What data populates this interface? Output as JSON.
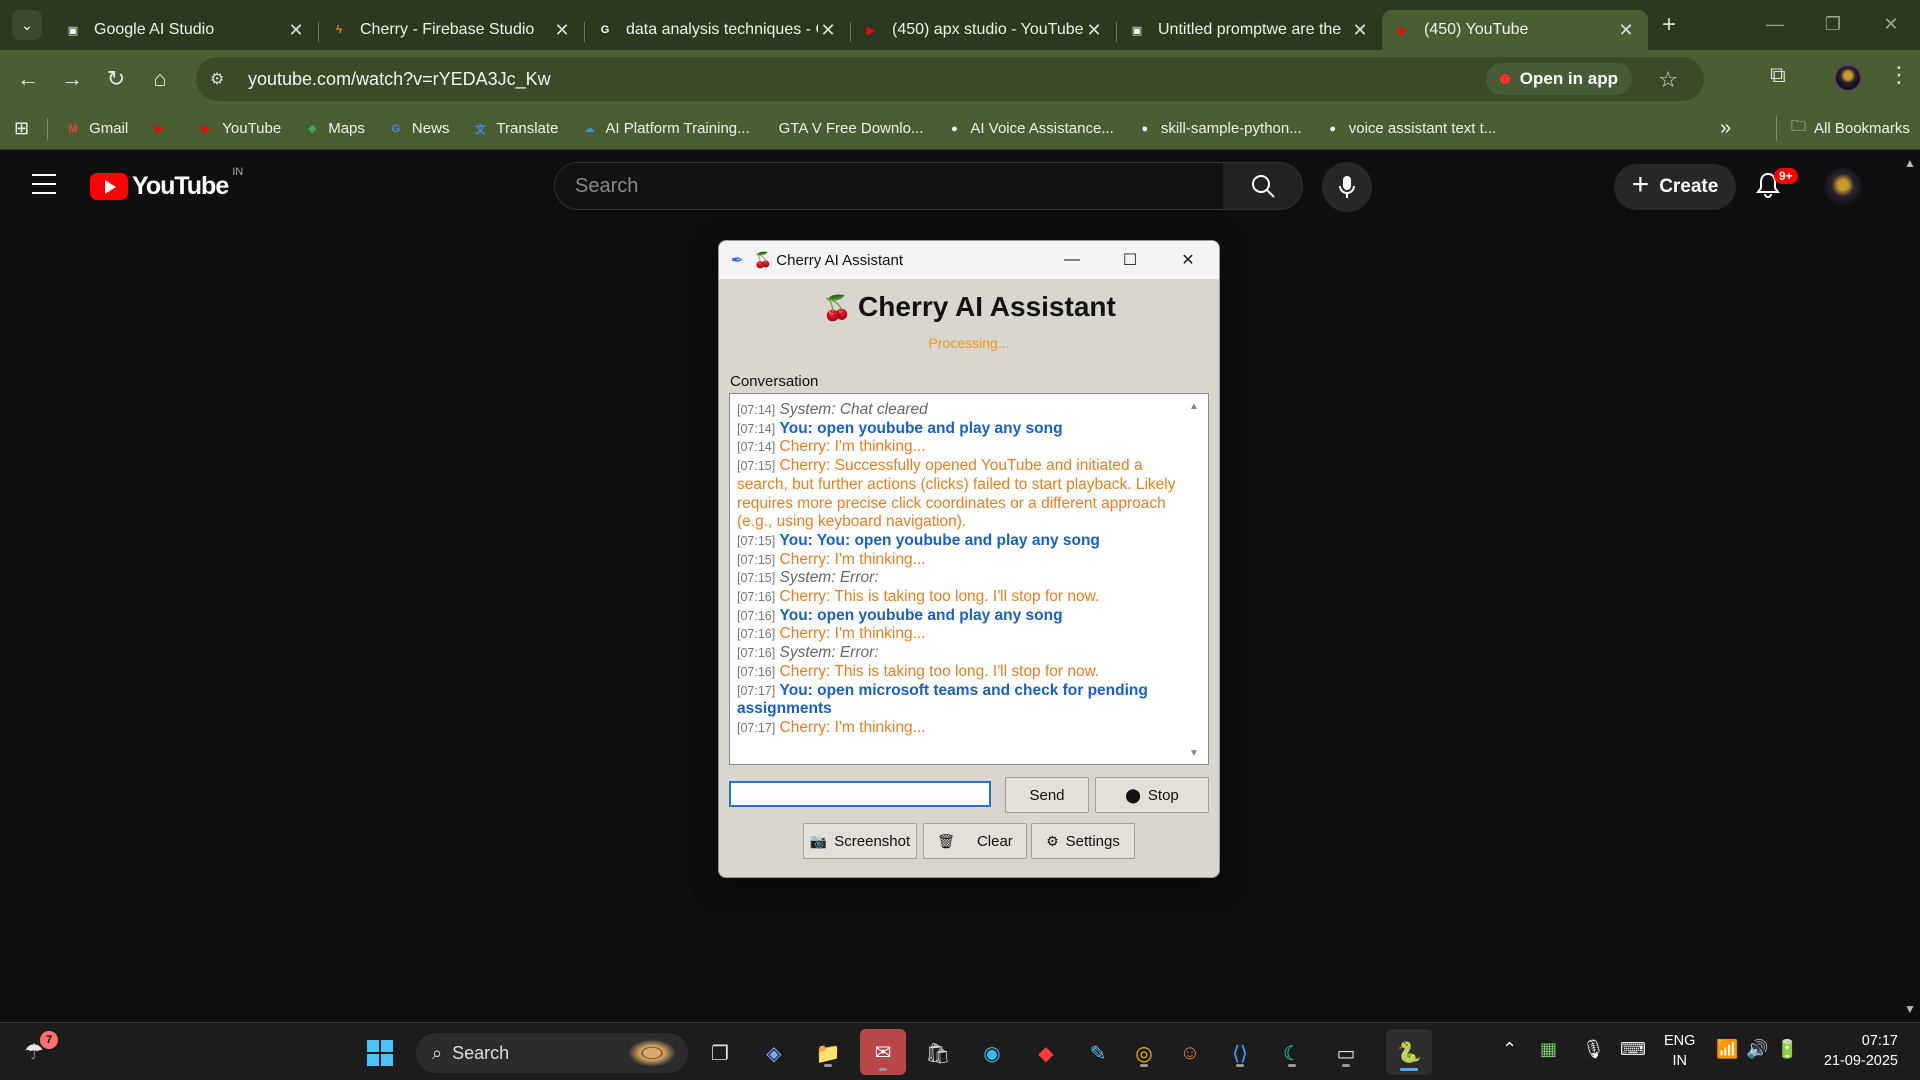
{
  "browser": {
    "tabs": [
      {
        "title": "Google AI Studio",
        "active": false,
        "fav_color": "#ffffff",
        "fav_glyph": "▣"
      },
      {
        "title": "Cherry - Firebase Studio",
        "active": false,
        "fav_color": "#ff7a1a",
        "fav_glyph": "ϟ"
      },
      {
        "title": "data analysis techniques - G",
        "active": false,
        "fav_color": "#ffffff",
        "fav_glyph": "G"
      },
      {
        "title": "(450) apx studio - YouTube",
        "active": false,
        "fav_color": "#ff0000",
        "fav_glyph": "▶"
      },
      {
        "title": "Untitled promptwe are the",
        "active": false,
        "fav_color": "#ffffff",
        "fav_glyph": "▣"
      },
      {
        "title": "(450) YouTube",
        "active": true,
        "fav_color": "#ff0000",
        "fav_glyph": "▶"
      }
    ],
    "url": "youtube.com/watch?v=rYEDA3Jc_Kw",
    "open_in_app": "Open in app",
    "bookmarks": [
      {
        "label": "Gmail",
        "color": "#ea4335",
        "glyph": "M"
      },
      {
        "label": "",
        "color": "#ff0000",
        "glyph": "▶"
      },
      {
        "label": "YouTube",
        "color": "#ff0000",
        "glyph": "▶"
      },
      {
        "label": "Maps",
        "color": "#34a853",
        "glyph": "◆"
      },
      {
        "label": "News",
        "color": "#4285f4",
        "glyph": "G"
      },
      {
        "label": "Translate",
        "color": "#4285f4",
        "glyph": "文"
      },
      {
        "label": "AI Platform Training...",
        "color": "#4285f4",
        "glyph": "☁"
      },
      {
        "label": "GTA V Free Downlo...",
        "color": "transparent",
        "glyph": ""
      },
      {
        "label": "AI Voice Assistance...",
        "color": "#ffffff",
        "glyph": "●"
      },
      {
        "label": "skill-sample-python...",
        "color": "#ffffff",
        "glyph": "●"
      },
      {
        "label": "voice assistant text t...",
        "color": "#ffffff",
        "glyph": "●"
      }
    ],
    "all_bookmarks": "All Bookmarks"
  },
  "youtube": {
    "wordmark": "YouTube",
    "country": "IN",
    "search_placeholder": "Search",
    "create_label": "Create",
    "notif_badge": "9+"
  },
  "app": {
    "window_title": "Cherry AI Assistant",
    "heading": "Cherry AI Assistant",
    "status": "Processing...",
    "conversation_label": "Conversation",
    "messages": [
      {
        "time": "[07:14]",
        "kind": "sys",
        "text": "System: Chat cleared"
      },
      {
        "time": "[07:14]",
        "kind": "you",
        "text": "You: open youbube and play any song"
      },
      {
        "time": "[07:14]",
        "kind": "ch",
        "text": "Cherry: I'm thinking..."
      },
      {
        "time": "[07:15]",
        "kind": "ch",
        "text": "Cherry: Successfully opened YouTube and initiated a search, but further actions (clicks) failed to start playback. Likely requires more precise click coordinates or a different approach (e.g., using keyboard navigation)."
      },
      {
        "time": "[07:15]",
        "kind": "you",
        "text": "You: You: open youbube and play any song"
      },
      {
        "time": "[07:15]",
        "kind": "ch",
        "text": "Cherry: I'm thinking..."
      },
      {
        "time": "[07:15]",
        "kind": "sys",
        "text": "System: Error:"
      },
      {
        "time": "[07:16]",
        "kind": "ch",
        "text": "Cherry: This is taking too long. I'll stop for now."
      },
      {
        "time": "[07:16]",
        "kind": "you",
        "text": "You: open youbube and play any song"
      },
      {
        "time": "[07:16]",
        "kind": "ch",
        "text": "Cherry: I'm thinking..."
      },
      {
        "time": "[07:16]",
        "kind": "sys",
        "text": "System: Error:"
      },
      {
        "time": "[07:16]",
        "kind": "ch",
        "text": "Cherry: This is taking too long. I'll stop for now."
      },
      {
        "time": "[07:17]",
        "kind": "you",
        "text": "You: open microsoft teams and check for pending assignments"
      },
      {
        "time": "[07:17]",
        "kind": "ch",
        "text": "Cherry: I'm thinking..."
      }
    ],
    "input_value": "",
    "send_label": "Send",
    "stop_label": "Stop",
    "screenshot_label": "Screenshot",
    "clear_label": "Clear",
    "settings_label": "Settings",
    "colors": {
      "user": "#1a5fc4",
      "cherry": "#e67e22",
      "system": "#666666",
      "status": "#f39c12"
    }
  },
  "taskbar": {
    "weather_badge": "7",
    "search_label": "Search",
    "lang_line1": "ENG",
    "lang_line2": "IN",
    "time": "07:17",
    "date": "21-09-2025"
  }
}
